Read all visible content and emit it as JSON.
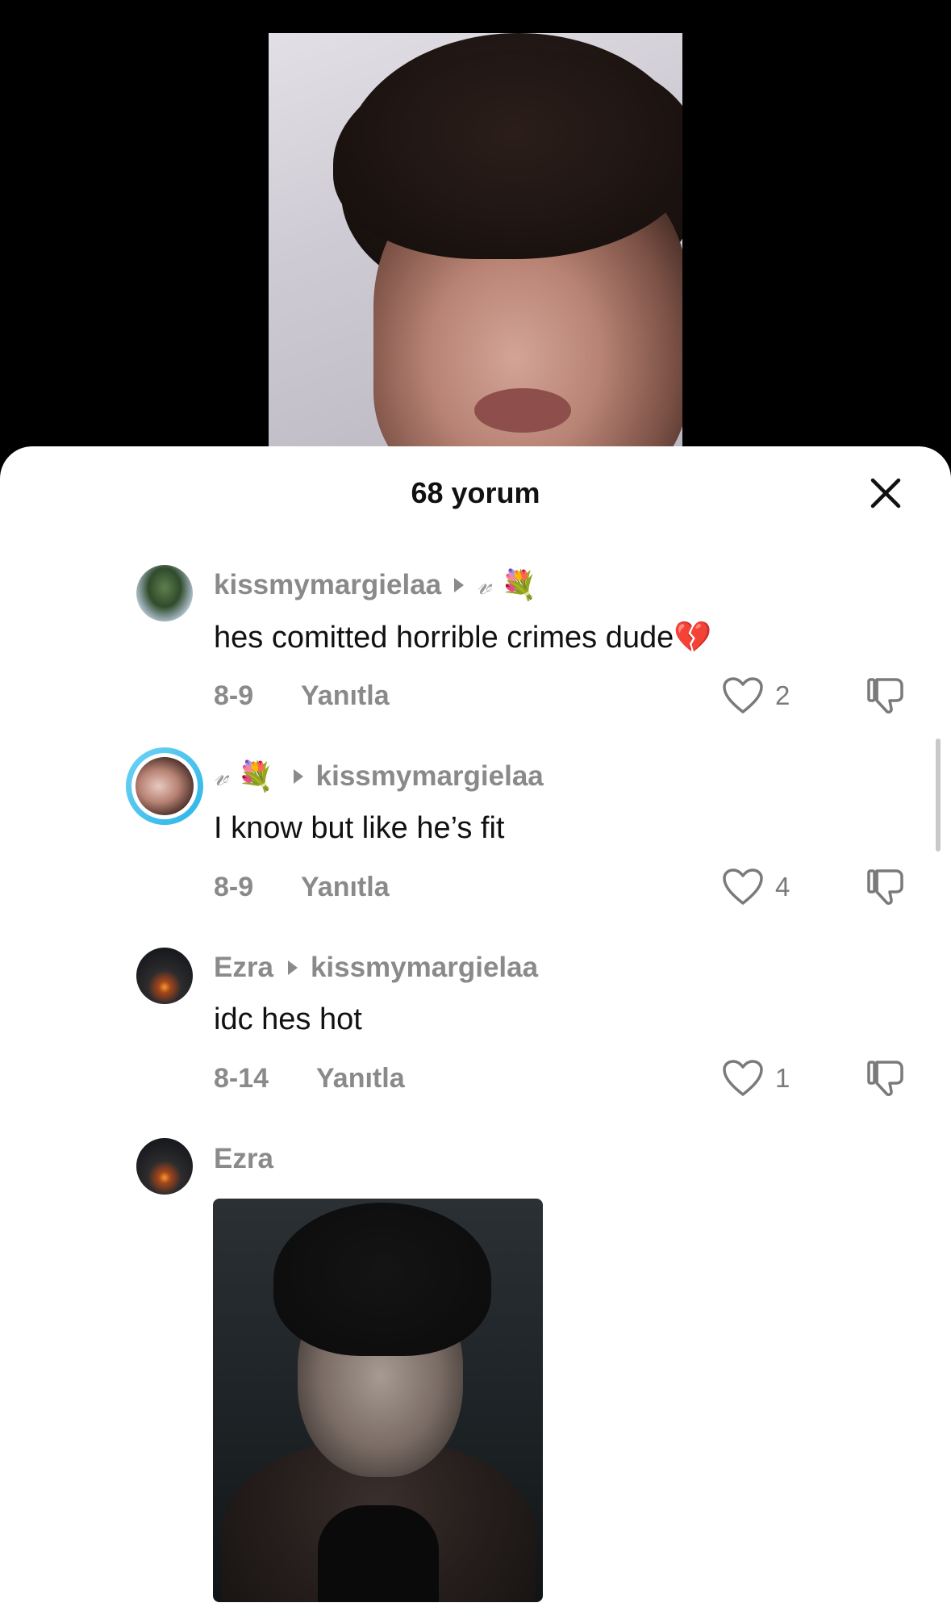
{
  "sheet": {
    "title": "68 yorum"
  },
  "comments": [
    {
      "username": "kissmymargielaa",
      "reply_to_v": "𝓋",
      "reply_to_emoji": "💐",
      "text": "hes comitted horrible crimes dude💔",
      "date": "8-9",
      "reply_label": "Yanıtla",
      "likes": "2"
    },
    {
      "username_v": "𝓋",
      "username_emoji": "💐",
      "reply_to": "kissmymargielaa",
      "text": "I know but like he’s fit",
      "date": "8-9",
      "reply_label": "Yanıtla",
      "likes": "4"
    },
    {
      "username": "Ezra",
      "reply_to": "kissmymargielaa",
      "text": "idc hes hot",
      "date": "8-14",
      "reply_label": "Yanıtla",
      "likes": "1"
    },
    {
      "username": "Ezra"
    }
  ],
  "colors": {
    "accent_ring": "#2bb5e8",
    "muted_text": "#8a8a8a",
    "main_text": "#111111"
  }
}
